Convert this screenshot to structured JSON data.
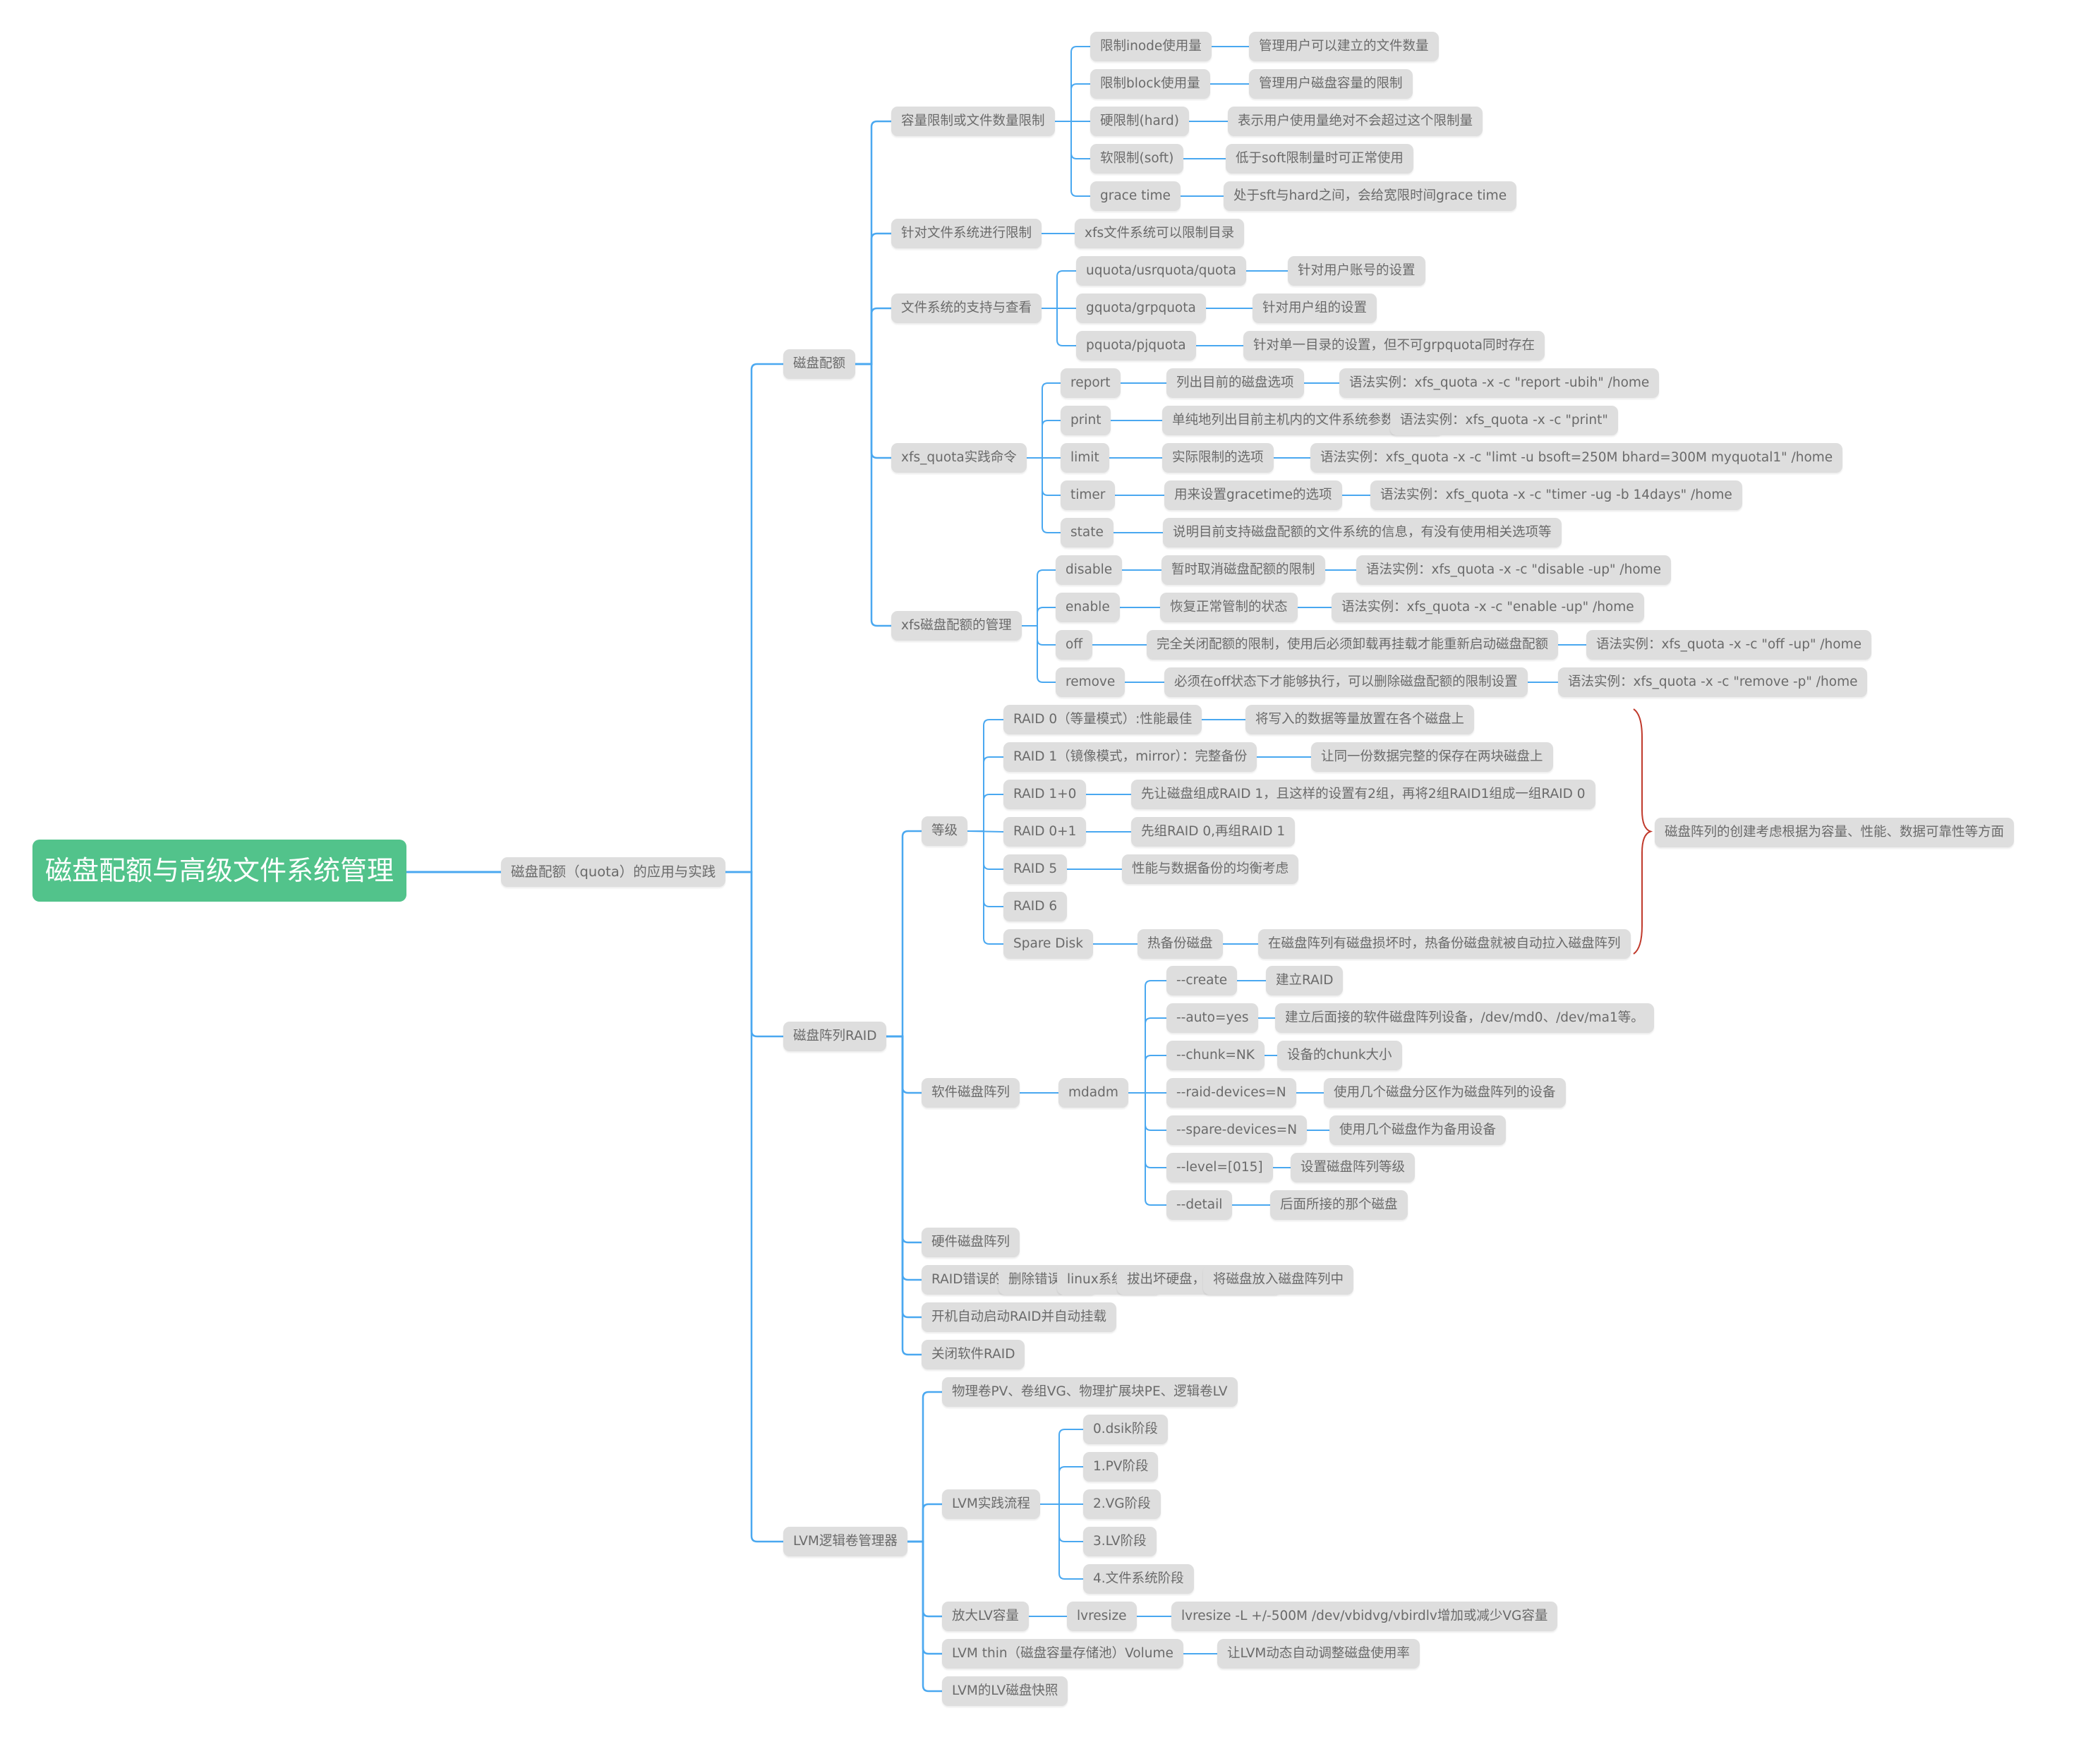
{
  "title": "磁盘配额与高级文件系统管理",
  "colors": {
    "root_bg": "#52c38b",
    "node_bg": "#dedede",
    "node_text": "#6a6a6a",
    "link": "#4aa8f0",
    "brace": "#c0392b"
  },
  "tree": {
    "label": "磁盘配额（quota）的应用与实践",
    "children": [
      {
        "label": "磁盘配额",
        "children": [
          {
            "label": "容量限制或文件数量限制",
            "children": [
              {
                "label": "限制inode使用量",
                "children": [
                  {
                    "label": "管理用户可以建立的文件数量"
                  }
                ]
              },
              {
                "label": "限制block使用量",
                "children": [
                  {
                    "label": "管理用户磁盘容量的限制"
                  }
                ]
              },
              {
                "label": "硬限制(hard)",
                "children": [
                  {
                    "label": "表示用户使用量绝对不会超过这个限制量"
                  }
                ]
              },
              {
                "label": "软限制(soft)",
                "children": [
                  {
                    "label": "低于soft限制量时可正常使用"
                  }
                ]
              },
              {
                "label": "grace time",
                "children": [
                  {
                    "label": "处于sft与hard之间，会给宽限时间grace time"
                  }
                ]
              }
            ]
          },
          {
            "label": "针对文件系统进行限制",
            "children": [
              {
                "label": "xfs文件系统可以限制目录"
              }
            ]
          },
          {
            "label": "文件系统的支持与查看",
            "children": [
              {
                "label": "uquota/usrquota/quota",
                "children": [
                  {
                    "label": "针对用户账号的设置"
                  }
                ]
              },
              {
                "label": "gquota/grpquota",
                "children": [
                  {
                    "label": "针对用户组的设置"
                  }
                ]
              },
              {
                "label": "pquota/pjquota",
                "children": [
                  {
                    "label": "针对单一目录的设置，但不可grpquota同时存在"
                  }
                ]
              }
            ]
          },
          {
            "label": "xfs_quota实践命令",
            "children": [
              {
                "label": "report",
                "children": [
                  {
                    "label": "列出目前的磁盘选项",
                    "children": [
                      {
                        "label": "语法实例：xfs_quota -x -c \"report -ubih\" /home"
                      }
                    ]
                  }
                ]
              },
              {
                "label": "print",
                "children": [
                  {
                    "label": "单纯地列出目前主机内的文件系统参数等数据",
                    "children": [
                      {
                        "label": "语法实例：xfs_quota -x -c \"print\""
                      }
                    ]
                  }
                ]
              },
              {
                "label": "limit",
                "children": [
                  {
                    "label": "实际限制的选项",
                    "children": [
                      {
                        "label": "语法实例：xfs_quota -x -c \"limt -u bsoft=250M bhard=300M myquotal1\" /home"
                      }
                    ]
                  }
                ]
              },
              {
                "label": "timer",
                "children": [
                  {
                    "label": "用来设置gracetime的选项",
                    "children": [
                      {
                        "label": "语法实例：xfs_quota -x -c \"timer -ug -b 14days\" /home"
                      }
                    ]
                  }
                ]
              },
              {
                "label": "state",
                "children": [
                  {
                    "label": "说明目前支持磁盘配额的文件系统的信息，有没有使用相关选项等"
                  }
                ]
              }
            ]
          },
          {
            "label": "xfs磁盘配额的管理",
            "children": [
              {
                "label": "disable",
                "children": [
                  {
                    "label": "暂时取消磁盘配额的限制",
                    "children": [
                      {
                        "label": "语法实例：xfs_quota -x -c \"disable -up\" /home"
                      }
                    ]
                  }
                ]
              },
              {
                "label": "enable",
                "children": [
                  {
                    "label": "恢复正常管制的状态",
                    "children": [
                      {
                        "label": "语法实例：xfs_quota -x -c \"enable -up\" /home"
                      }
                    ]
                  }
                ]
              },
              {
                "label": "off",
                "children": [
                  {
                    "label": "完全关闭配额的限制，使用后必须卸载再挂载才能重新启动磁盘配额",
                    "children": [
                      {
                        "label": "语法实例：xfs_quota -x -c \"off -up\" /home"
                      }
                    ]
                  }
                ]
              },
              {
                "label": "remove",
                "children": [
                  {
                    "label": "必须在off状态下才能够执行，可以删除磁盘配额的限制设置",
                    "children": [
                      {
                        "label": "语法实例：xfs_quota -x -c \"remove -p\" /home"
                      }
                    ]
                  }
                ]
              }
            ]
          }
        ]
      },
      {
        "label": "磁盘阵列RAID",
        "children": [
          {
            "label": "等级",
            "children": [
              {
                "label": "RAID 0（等量模式）:性能最佳",
                "children": [
                  {
                    "label": "将写入的数据等量放置在各个磁盘上"
                  }
                ]
              },
              {
                "label": "RAID 1（镜像模式，mirror）：完整备份",
                "children": [
                  {
                    "label": "让同一份数据完整的保存在两块磁盘上"
                  }
                ]
              },
              {
                "label": "RAID 1+0",
                "children": [
                  {
                    "label": "先让磁盘组成RAID 1，且这样的设置有2组，再将2组RAID1组成一组RAID 0"
                  }
                ]
              },
              {
                "label": "RAID 0+1",
                "children": [
                  {
                    "label": "先组RAID 0,再组RAID 1"
                  }
                ]
              },
              {
                "label": "RAID 5",
                "children": [
                  {
                    "label": "性能与数据备份的均衡考虑"
                  }
                ]
              },
              {
                "label": "RAID 6"
              },
              {
                "label": "Spare Disk",
                "children": [
                  {
                    "label": "热备份磁盘",
                    "children": [
                      {
                        "label": "在磁盘阵列有磁盘损坏时，热备份磁盘就被自动拉入磁盘阵列"
                      }
                    ]
                  }
                ]
              }
            ]
          },
          {
            "label": "软件磁盘阵列",
            "children": [
              {
                "label": "mdadm",
                "children": [
                  {
                    "label": "--create",
                    "children": [
                      {
                        "label": "建立RAID"
                      }
                    ]
                  },
                  {
                    "label": "--auto=yes",
                    "children": [
                      {
                        "label": "建立后面接的软件磁盘阵列设备，/dev/md0、/dev/ma1等。"
                      }
                    ]
                  },
                  {
                    "label": "--chunk=NK",
                    "children": [
                      {
                        "label": "设备的chunk大小"
                      }
                    ]
                  },
                  {
                    "label": "--raid-devices=N",
                    "children": [
                      {
                        "label": "使用几个磁盘分区作为磁盘阵列的设备"
                      }
                    ]
                  },
                  {
                    "label": "--spare-devices=N",
                    "children": [
                      {
                        "label": "使用几个磁盘作为备用设备"
                      }
                    ]
                  },
                  {
                    "label": "--level=[015]",
                    "children": [
                      {
                        "label": "设置磁盘阵列等级"
                      }
                    ]
                  },
                  {
                    "label": "--detail",
                    "children": [
                      {
                        "label": "后面所接的那个磁盘"
                      }
                    ]
                  }
                ]
              }
            ]
          },
          {
            "label": "硬件磁盘阵列"
          },
          {
            "label": "RAID错误的恢复模式",
            "children": [
              {
                "label": "删除错误磁盘",
                "children": [
                  {
                    "label": "linux系统关机",
                    "children": [
                      {
                        "label": "拔出坏硬盘，安装新硬盘",
                        "children": [
                          {
                            "label": "将磁盘放入磁盘阵列中"
                          }
                        ]
                      }
                    ]
                  }
                ]
              }
            ]
          },
          {
            "label": "开机自动启动RAID并自动挂载"
          },
          {
            "label": "关闭软件RAID"
          }
        ]
      },
      {
        "label": "LVM逻辑卷管理器",
        "children": [
          {
            "label": "物理卷PV、卷组VG、物理扩展块PE、逻辑卷LV"
          },
          {
            "label": "LVM实践流程",
            "children": [
              {
                "label": "0.dsik阶段"
              },
              {
                "label": "1.PV阶段"
              },
              {
                "label": "2.VG阶段"
              },
              {
                "label": "3.LV阶段"
              },
              {
                "label": "4.文件系统阶段"
              }
            ]
          },
          {
            "label": "放大LV容量",
            "children": [
              {
                "label": "lvresize",
                "children": [
                  {
                    "label": "lvresize -L +/-500M /dev/vbidvg/vbirdlv增加或减少VG容量"
                  }
                ]
              }
            ]
          },
          {
            "label": "LVM thin（磁盘容量存储池）Volume",
            "children": [
              {
                "label": "让LVM动态自动调整磁盘使用率"
              }
            ]
          },
          {
            "label": "LVM的LV磁盘快照"
          }
        ]
      }
    ]
  },
  "summary": {
    "label": "磁盘阵列的创建考虑根据为容量、性能、数据可靠性等方面"
  }
}
